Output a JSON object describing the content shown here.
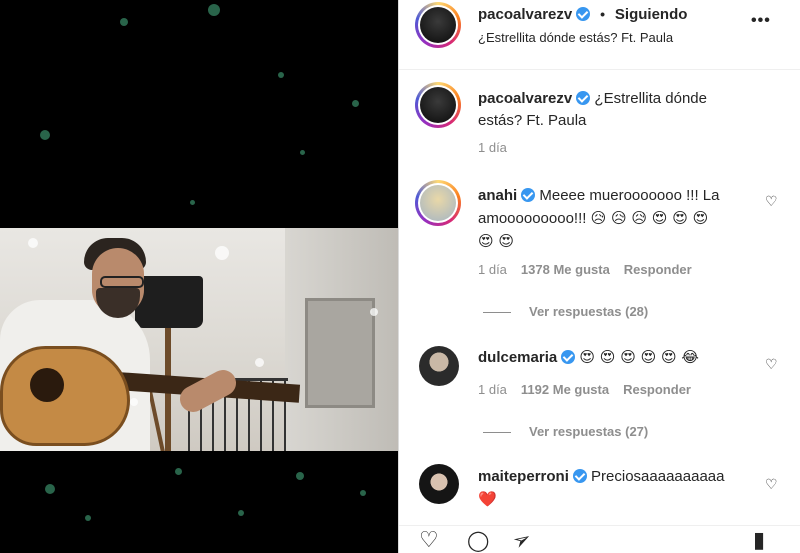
{
  "post": {
    "author": "pacoalvarezv",
    "follow_status": "Siguiendo",
    "separator": "•",
    "subtitle": "¿Estrellita dónde estás? Ft. Paula",
    "more_icon": "•••"
  },
  "caption": {
    "username": "pacoalvarezv",
    "text": "¿Estrellita dónde estás? Ft. Paula",
    "time": "1 día"
  },
  "comments": [
    {
      "username": "anahi",
      "text_line1": "Meeee muerooooooo !!! La",
      "text_line2": "amooooooooo!!!",
      "emojis_inline": "😥 😥 😥 😍 😍 😍",
      "emojis_line3": "😍 😍",
      "time": "1 día",
      "likes": "1378 Me gusta",
      "reply": "Responder",
      "view_replies": "Ver respuestas (28)"
    },
    {
      "username": "dulcemaria",
      "emojis": "😍 😍 😍 😍 😍 😂",
      "time": "1 día",
      "likes": "1192 Me gusta",
      "reply": "Responder",
      "view_replies": "Ver respuestas (27)"
    },
    {
      "username": "maiteperroni",
      "text": "Preciosaaaaaaaaaa",
      "emoji_line2": "❤️"
    }
  ],
  "icons": {
    "like": "♡",
    "comment": "◯",
    "share": "➢",
    "save": "▮",
    "comment_heart": "♡"
  }
}
